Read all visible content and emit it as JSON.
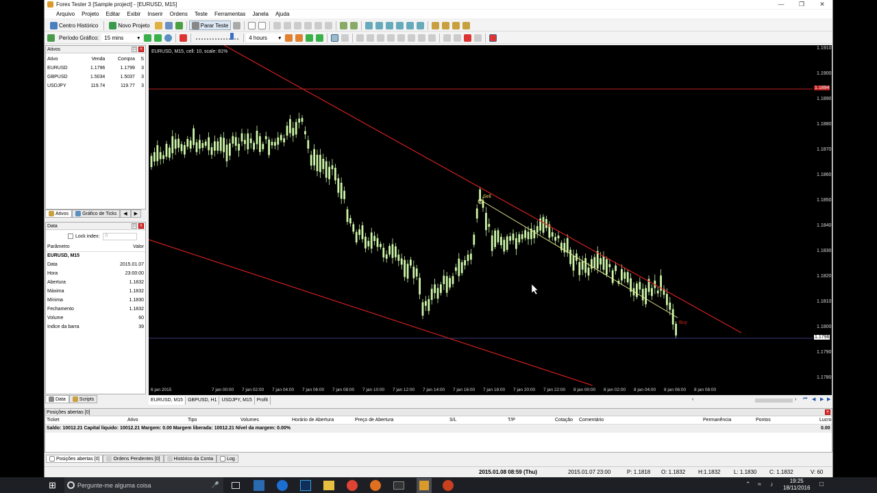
{
  "window": {
    "title": "Forex Tester 3  [Sample project] - [EURUSD, M15]"
  },
  "menu": [
    "Arquivo",
    "Projeto",
    "Editar",
    "Exibir",
    "Inserir",
    "Ordens",
    "Teste",
    "Ferramentas",
    "Janela",
    "Ajuda"
  ],
  "toolbar1": {
    "history_label": "Centro Histórico",
    "new_project_label": "Novo Projeto",
    "stop_test_label": "Parar Teste"
  },
  "toolbar2": {
    "period_label": "Período Gráfico:",
    "period_value": "15 mins",
    "step_value": "4 hours"
  },
  "symbols_panel": {
    "title": "Ativos",
    "headers": [
      "Ativo",
      "Venda",
      "Compra",
      "S"
    ],
    "rows": [
      [
        "EURUSD",
        "1.1796",
        "1.1799",
        "3"
      ],
      [
        "GBPUSD",
        "1.5034",
        "1.5037",
        "3"
      ],
      [
        "USDJPY",
        "119.74",
        "119.77",
        "3"
      ]
    ],
    "tabs": [
      "Ativos",
      "Gráfico de Ticks"
    ]
  },
  "data_panel": {
    "title": "Data",
    "lock_label": "Lock index:",
    "lock_value": "0",
    "headers": [
      "Parâmetro",
      "Valor"
    ],
    "symbol_row": "EURUSD, M15",
    "rows": [
      [
        "Data",
        "2015.01.07"
      ],
      [
        "Hora",
        "23:00:00"
      ],
      [
        "Abertura",
        "1.1832"
      ],
      [
        "Máxima",
        "1.1832"
      ],
      [
        "Mínima",
        "1.1830"
      ],
      [
        "Fechamento",
        "1.1832"
      ],
      [
        "Volume",
        "60"
      ],
      [
        "Indice da barra",
        "39"
      ]
    ],
    "tabs": [
      "Data",
      "Scripts"
    ]
  },
  "chart": {
    "info": "EURUSD, M15, cell: 10, scale: 81%",
    "sell_label": "Sell",
    "buy_label": "Buy",
    "price_levels": [
      "1.1910",
      "1.1900",
      "1.1890",
      "1.1880",
      "1.1870",
      "1.1860",
      "1.1850",
      "1.1840",
      "1.1830",
      "1.1820",
      "1.1810",
      "1.1800",
      "1.1790",
      "1.1780"
    ],
    "hline_price_label": "1.1894",
    "current_price_label": "1.1796",
    "time_labels": [
      "6 jan 2015",
      "7 jan 00:00",
      "7 jan 02:00",
      "7 jan 04:00",
      "7 jan 06:00",
      "7 jan 08:00",
      "7 jan 10:00",
      "7 jan 12:00",
      "7 jan 14:00",
      "7 jan 16:00",
      "7 jan 18:00",
      "7 jan 20:00",
      "7 jan 22:00",
      "8 jan 00:00",
      "8 jan 02:00",
      "8 jan 04:00",
      "8 jan 06:00",
      "8 jan 08:00"
    ],
    "tabs": [
      "EURUSD, M15",
      "GBPUSD, H1",
      "USDJPY, M15",
      "Profit"
    ],
    "colors": {
      "candle": "#cdf6a8",
      "trendline": "#d42020",
      "yellow_line": "#e8e890"
    }
  },
  "positions": {
    "title": "Posições abertas [0]",
    "headers": [
      "Ticket",
      "Ativo",
      "Tipo",
      "Volumes",
      "Horário de Abertura",
      "Preço de Abertura",
      "S/L",
      "T/P",
      "Cotação",
      "Comentário",
      "Permanência",
      "Pontos",
      "Lucro"
    ],
    "balance_line": "Saldo: 10012.21 Capital líquido: 10012.21 Margem: 0.00 Margem liberada: 10012.21 Nível da margem: 0.00%",
    "balance_value": "0.00",
    "tabs": [
      "Posições abertas [0]",
      "Ordens Pendentes [0]",
      "Histórico da Conta",
      "Log"
    ]
  },
  "statusbar": {
    "datetime": "2015.01.08 08:59 (Thu)",
    "bar_time": "2015.01.07 23:00",
    "p": "P: 1.1818",
    "o": "O: 1.1832",
    "h": "H:1.1832",
    "l": "L: 1.1830",
    "c": "C: 1.1832",
    "v": "V: 60"
  },
  "taskbar": {
    "search_placeholder": "Pergunte-me alguma coisa",
    "time": "19:25",
    "date": "18/11/2016"
  }
}
